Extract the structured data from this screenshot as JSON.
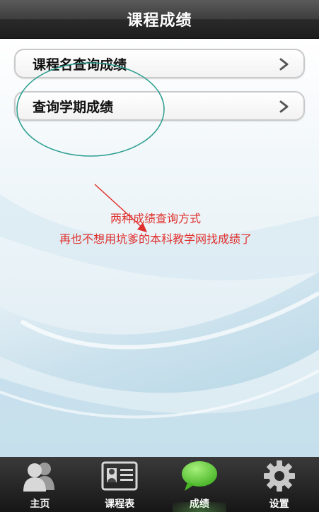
{
  "header": {
    "title": "课程成绩"
  },
  "menu": [
    {
      "label": "课程名查询成绩"
    },
    {
      "label": "查询学期成绩"
    }
  ],
  "annotation": {
    "line1": "两种成绩查询方式",
    "line2": "再也不想用坑爹的本科教学网找成绩了",
    "color": "#e0302c"
  },
  "tabbar": {
    "items": [
      {
        "label": "主页",
        "icon": "users-icon"
      },
      {
        "label": "课程表",
        "icon": "id-card-icon"
      },
      {
        "label": "成绩",
        "icon": "chat-bubble-icon",
        "active": true
      },
      {
        "label": "设置",
        "icon": "gear-icon"
      }
    ]
  }
}
